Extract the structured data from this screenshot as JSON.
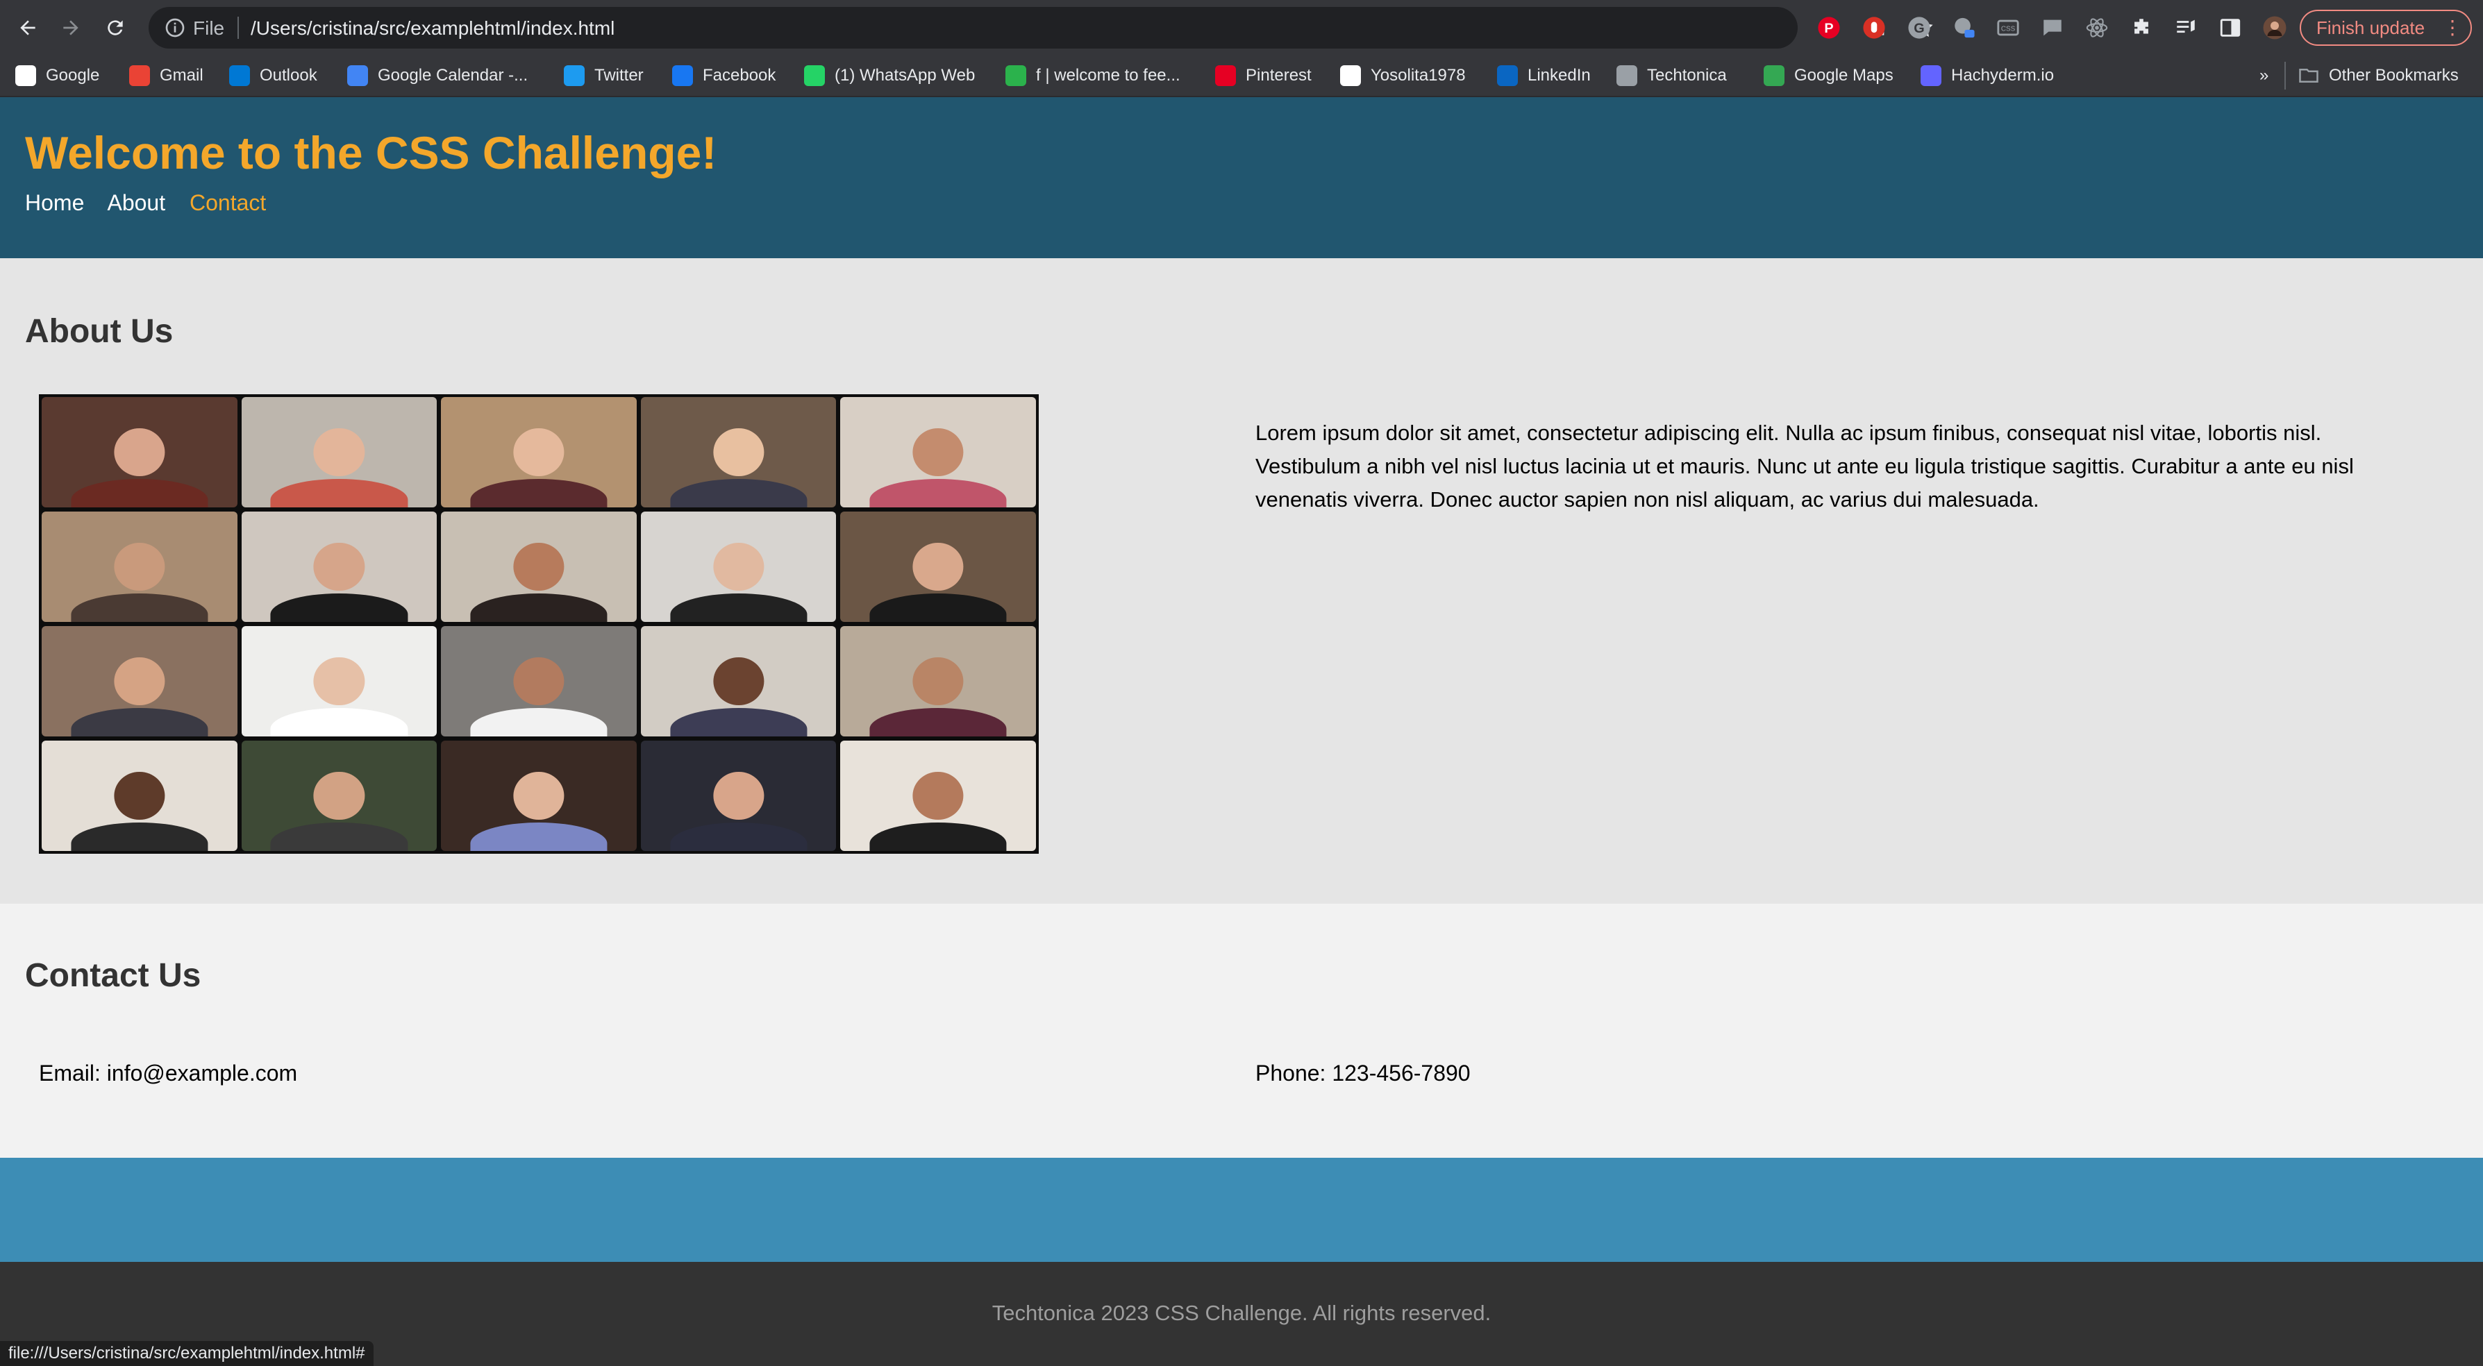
{
  "browser": {
    "omnibox": {
      "scheme_label": "File",
      "url": "/Users/cristina/src/examplehtml/index.html"
    },
    "finish_update_label": "Finish update",
    "bookmarks": [
      {
        "label": "Google",
        "icon": "google-icon",
        "color": "#ffffff"
      },
      {
        "label": "Gmail",
        "icon": "gmail-icon",
        "color": "#ea4335"
      },
      {
        "label": "Outlook",
        "icon": "outlook-icon",
        "color": "#0078d4"
      },
      {
        "label": "Google Calendar -...",
        "icon": "calendar-icon",
        "color": "#4285f4"
      },
      {
        "label": "Twitter",
        "icon": "twitter-icon",
        "color": "#1d9bf0"
      },
      {
        "label": "Facebook",
        "icon": "facebook-icon",
        "color": "#1877f2"
      },
      {
        "label": "(1) WhatsApp Web",
        "icon": "whatsapp-icon",
        "color": "#25d366"
      },
      {
        "label": "f | welcome to fee...",
        "icon": "feedly-icon",
        "color": "#2bb24c"
      },
      {
        "label": "Pinterest",
        "icon": "pinterest-icon",
        "color": "#e60023"
      },
      {
        "label": "Yosolita1978",
        "icon": "github-icon",
        "color": "#ffffff"
      },
      {
        "label": "LinkedIn",
        "icon": "linkedin-icon",
        "color": "#0a66c2"
      },
      {
        "label": "Techtonica",
        "icon": "folder-icon",
        "color": "#9aa0a6"
      },
      {
        "label": "Google Maps",
        "icon": "maps-icon",
        "color": "#34a853"
      },
      {
        "label": "Hachyderm.io",
        "icon": "mastodon-icon",
        "color": "#6364ff"
      }
    ],
    "overflow_label": "»",
    "other_bookmarks_label": "Other Bookmarks",
    "status_url": "file:///Users/cristina/src/examplehtml/index.html#"
  },
  "page": {
    "title": "Welcome to the CSS Challenge!",
    "nav": [
      {
        "label": "Home",
        "active": false
      },
      {
        "label": "About",
        "active": false
      },
      {
        "label": "Contact",
        "active": true
      }
    ],
    "about": {
      "heading": "About Us",
      "paragraph": "Lorem ipsum dolor sit amet, consectetur adipiscing elit. Nulla ac ipsum finibus, consequat nisl vitae, lobortis nisl. Vestibulum a nibh vel nisl luctus lacinia ut et mauris. Nunc ut ante eu ligula tristique sagittis. Curabitur a ante eu nisl venenatis viverra. Donec auctor sapien non nisl aliquam, ac varius dui malesuada.",
      "gallery_tiles": [
        {
          "bg": "#5a3a30",
          "skin": "#d9a58c",
          "shirt": "#6b2a22"
        },
        {
          "bg": "#bdb6ad",
          "skin": "#e3b59a",
          "shirt": "#c9584a"
        },
        {
          "bg": "#b39270",
          "skin": "#e5b99c",
          "shirt": "#5b2b2e"
        },
        {
          "bg": "#6e5a4a",
          "skin": "#e8c0a0",
          "shirt": "#3a3a4a"
        },
        {
          "bg": "#d8cfc5",
          "skin": "#c48c6e",
          "shirt": "#c0556a"
        },
        {
          "bg": "#a88c72",
          "skin": "#c99a7c",
          "shirt": "#4a3a33"
        },
        {
          "bg": "#cfc7bf",
          "skin": "#d6a58a",
          "shirt": "#1b1b1b"
        },
        {
          "bg": "#c8bfb3",
          "skin": "#b77b5c",
          "shirt": "#2a2220"
        },
        {
          "bg": "#d7d4d0",
          "skin": "#e1b9a0",
          "shirt": "#222222"
        },
        {
          "bg": "#6b5645",
          "skin": "#d9a88c",
          "shirt": "#1a1a1a"
        },
        {
          "bg": "#8a7160",
          "skin": "#d5a384",
          "shirt": "#3b3a44"
        },
        {
          "bg": "#eeeeec",
          "skin": "#e6c0a7",
          "shirt": "#ffffff"
        },
        {
          "bg": "#7e7b78",
          "skin": "#b27b5f",
          "shirt": "#f2f2f2"
        },
        {
          "bg": "#d2ccc4",
          "skin": "#6b4330",
          "shirt": "#3d3d55"
        },
        {
          "bg": "#b8aa99",
          "skin": "#b98566",
          "shirt": "#5b2738"
        },
        {
          "bg": "#e4ded6",
          "skin": "#5e3b2a",
          "shirt": "#2a2a2a"
        },
        {
          "bg": "#3e4a36",
          "skin": "#d2a284",
          "shirt": "#3a3a3a"
        },
        {
          "bg": "#3a2a24",
          "skin": "#e0b499",
          "shirt": "#7b86c4"
        },
        {
          "bg": "#2a2b35",
          "skin": "#d8a58a",
          "shirt": "#2b2d3e"
        },
        {
          "bg": "#e8e2da",
          "skin": "#b47a5c",
          "shirt": "#1e1e1e"
        }
      ]
    },
    "contact": {
      "heading": "Contact Us",
      "email": "Email: info@example.com",
      "phone": "Phone: 123-456-7890"
    },
    "footer": "Techtonica 2023 CSS Challenge. All rights reserved."
  }
}
